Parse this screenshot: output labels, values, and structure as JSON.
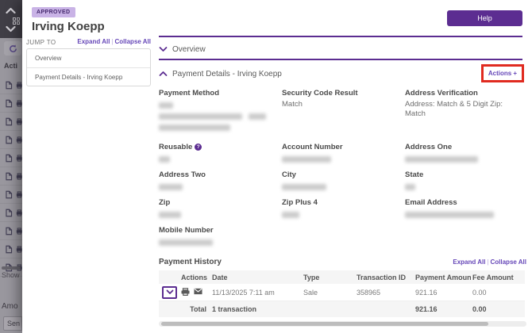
{
  "header": {
    "badge": "APPROVED",
    "title": "Irving Koepp",
    "help_label": "Help"
  },
  "jump_to": {
    "label": "JUMP TO",
    "expand_all": "Expand All",
    "separator": "|",
    "collapse_all": "Collapse All",
    "items": [
      "Overview",
      "Payment Details - Irving Koepp"
    ]
  },
  "sections": {
    "overview_title": "Overview",
    "details_title": "Payment Details - Irving Koepp",
    "actions_label": "Actions +"
  },
  "fields": [
    {
      "label": "Payment Method",
      "redacted": true,
      "blobs": [
        [
          18
        ],
        [
          105,
          22
        ],
        [
          90
        ]
      ]
    },
    {
      "label": "Security Code Result",
      "value": "Match"
    },
    {
      "label": "Address Verification",
      "value": "Address: Match & 5 Digit Zip: Match"
    },
    {
      "label": "Reusable",
      "help_icon": true,
      "redacted": true,
      "blobs": [
        [
          14
        ]
      ]
    },
    {
      "label": "Account Number",
      "redacted": true,
      "blobs": [
        [
          62
        ]
      ]
    },
    {
      "label": "Address One",
      "redacted": true,
      "blobs": [
        [
          92
        ]
      ]
    },
    {
      "label": "Address Two",
      "redacted": true,
      "blobs": [
        [
          30
        ]
      ]
    },
    {
      "label": "City",
      "redacted": true,
      "blobs": [
        [
          56
        ]
      ]
    },
    {
      "label": "State",
      "redacted": true,
      "blobs": [
        [
          13
        ]
      ]
    },
    {
      "label": "Zip",
      "redacted": true,
      "blobs": [
        [
          28
        ]
      ]
    },
    {
      "label": "Zip Plus 4",
      "redacted": true,
      "blobs": [
        [
          22
        ]
      ]
    },
    {
      "label": "Email Address",
      "redacted": true,
      "blobs": [
        [
          112
        ]
      ]
    },
    {
      "label": "Mobile Number",
      "redacted": true,
      "blobs": [
        [
          68
        ]
      ]
    }
  ],
  "payment_history": {
    "title": "Payment History",
    "expand_all": "Expand All",
    "separator": "|",
    "collapse_all": "Collapse All",
    "columns": [
      "Actions",
      "Date",
      "Type",
      "Transaction ID",
      "Payment Amount",
      "Fee Amount"
    ],
    "rows": [
      {
        "date": "11/13/2025 7:11 am",
        "type": "Sale",
        "transaction_id": "358965",
        "payment_amount": "921.16",
        "fee_amount": "0.00"
      }
    ],
    "total": {
      "label": "Total",
      "count": "1 transaction",
      "payment_amount": "921.16",
      "fee_amount": "0.00"
    }
  },
  "background": {
    "actions_header": "Acti",
    "show_label": "Show",
    "amount_label": "Amo",
    "send_label": "Sen",
    "row_count": 11
  },
  "colors": {
    "accent_purple": "#5C2D91",
    "link_purple": "#6647B8",
    "badge_bg": "#C9B3E6",
    "annotation_red": "#E02B20"
  }
}
